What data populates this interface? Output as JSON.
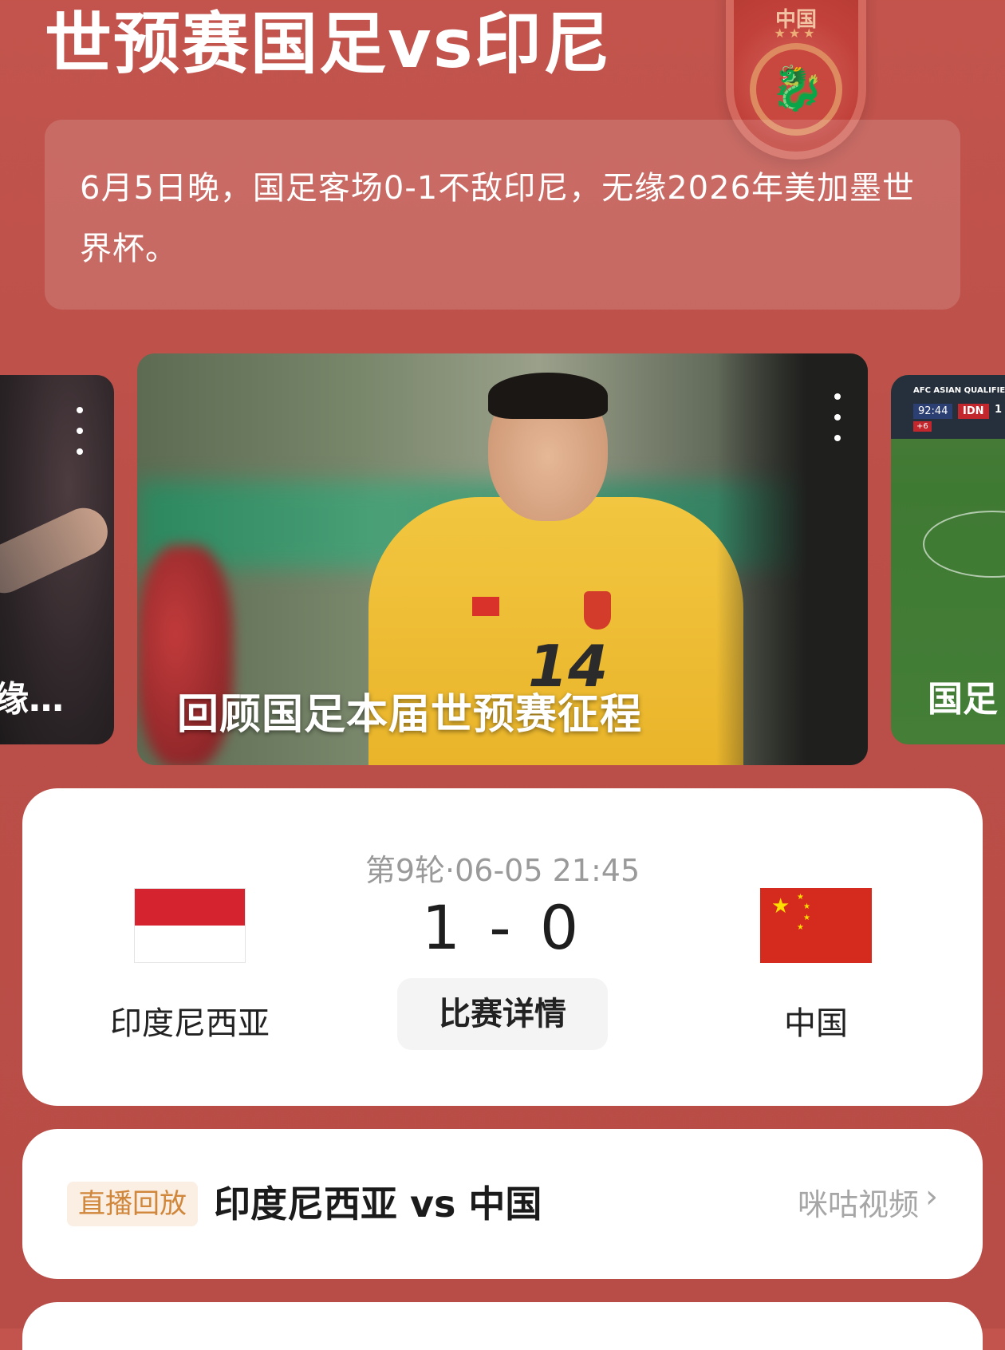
{
  "header": {
    "title": "世预赛国足vs印尼",
    "emblem_text": "中国"
  },
  "summary": {
    "text": "6月5日晚，国足客场0-1不敌印尼，无缘2026年美加墨世界杯。"
  },
  "carousel": {
    "left_card": {
      "caption": "缘…"
    },
    "main_card": {
      "caption": "回顾国足本届世预赛征程"
    },
    "right_card": {
      "caption": "国足",
      "scoreboard_label": "AFC ASIAN QUALIFIE",
      "scoreboard_time": "92:44",
      "scoreboard_team": "IDN",
      "scoreboard_score": "1",
      "scoreboard_added": "+6"
    }
  },
  "match": {
    "meta": "第9轮·06-05 21:45",
    "score": "1 - 0",
    "detail_button": "比赛详情",
    "home": {
      "name": "印度尼西亚",
      "flag_icon": "indonesia-flag-icon"
    },
    "away": {
      "name": "中国",
      "flag_icon": "china-flag-icon"
    }
  },
  "replay": {
    "tag": "直播回放",
    "title": "印度尼西亚 vs 中国",
    "provider": "咪咕视频",
    "chevron": "›"
  },
  "colors": {
    "background": "#bf524b",
    "card": "#ffffff",
    "tag_text": "#d0873b",
    "tag_bg": "#fbeee2"
  }
}
